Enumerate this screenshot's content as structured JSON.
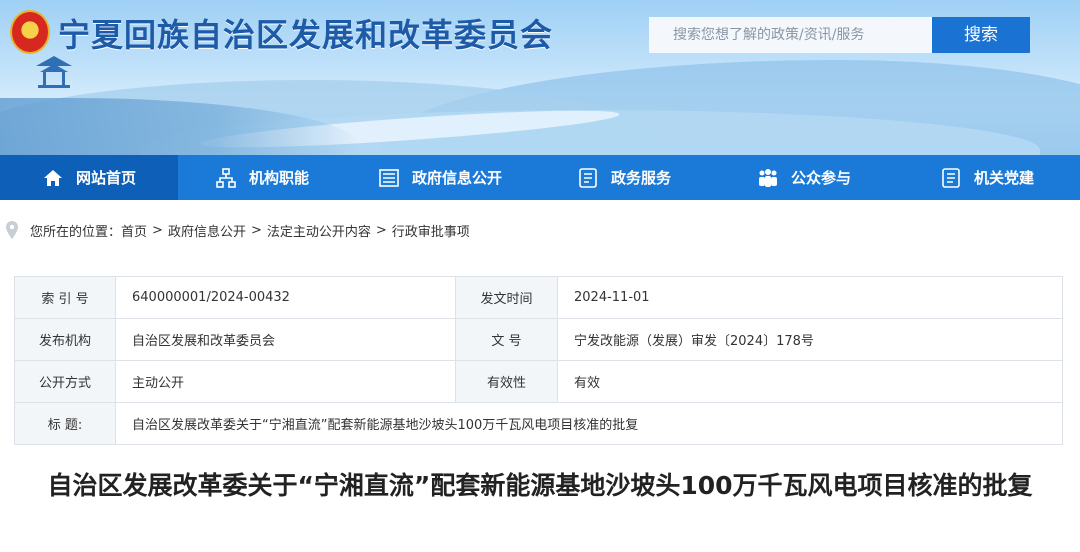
{
  "site": {
    "title": "宁夏回族自治区发展和改革委员会"
  },
  "search": {
    "placeholder": "搜索您想了解的政策/资讯/服务",
    "button": "搜索"
  },
  "nav": [
    {
      "label": "网站首页",
      "icon": "home-icon"
    },
    {
      "label": "机构职能",
      "icon": "org-chart-icon"
    },
    {
      "label": "政府信息公开",
      "icon": "newspaper-icon"
    },
    {
      "label": "政务服务",
      "icon": "document-list-icon"
    },
    {
      "label": "公众参与",
      "icon": "people-icon"
    },
    {
      "label": "机关党建",
      "icon": "document-icon"
    }
  ],
  "breadcrumb": {
    "prefix": "您所在的位置：",
    "items": [
      "首页",
      "政府信息公开",
      "法定主动公开内容",
      "行政审批事项"
    ]
  },
  "info": {
    "index_label": "索 引 号",
    "index_value": "640000001/2024-00432",
    "date_label": "发文时间",
    "date_value": "2024-11-01",
    "publisher_label": "发布机构",
    "publisher_value": "自治区发展和改革委员会",
    "docno_label": "文  号",
    "docno_value": "宁发改能源（发展）审发〔2024〕178号",
    "mode_label": "公开方式",
    "mode_value": "主动公开",
    "validity_label": "有效性",
    "validity_value": "有效",
    "title_label": "标  题:",
    "title_value": "自治区发展改革委关于“宁湘直流”配套新能源基地沙坡头100万千瓦风电项目核准的批复"
  },
  "article": {
    "title": "自治区发展改革委关于“宁湘直流”配套新能源基地沙坡头100万千瓦风电项目核准的批复"
  }
}
